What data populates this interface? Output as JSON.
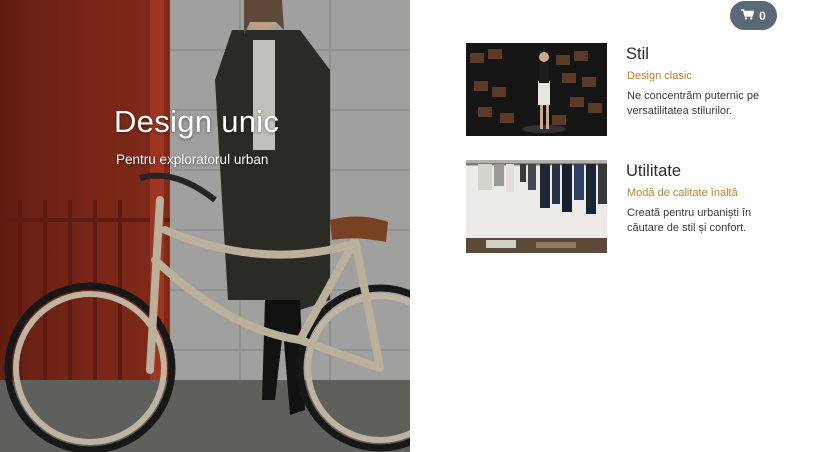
{
  "hero": {
    "title": "Design unic",
    "subtitle": "Pentru exploratorul urban"
  },
  "cart": {
    "icon": "shopping-cart-icon",
    "count": "0",
    "color": "#5a6877"
  },
  "features": [
    {
      "title": "Stil",
      "subtitle": "Design clasic",
      "description": "Ne concentrăm puternic pe versatilitatea stilurilor."
    },
    {
      "title": "Utilitate",
      "subtitle": "Modă de calitate înaltă",
      "description": "Creată pentru urbaniști în căutare de stil și confort."
    }
  ],
  "colors": {
    "accent": "#c0812a",
    "text": "#2b2b2b"
  }
}
